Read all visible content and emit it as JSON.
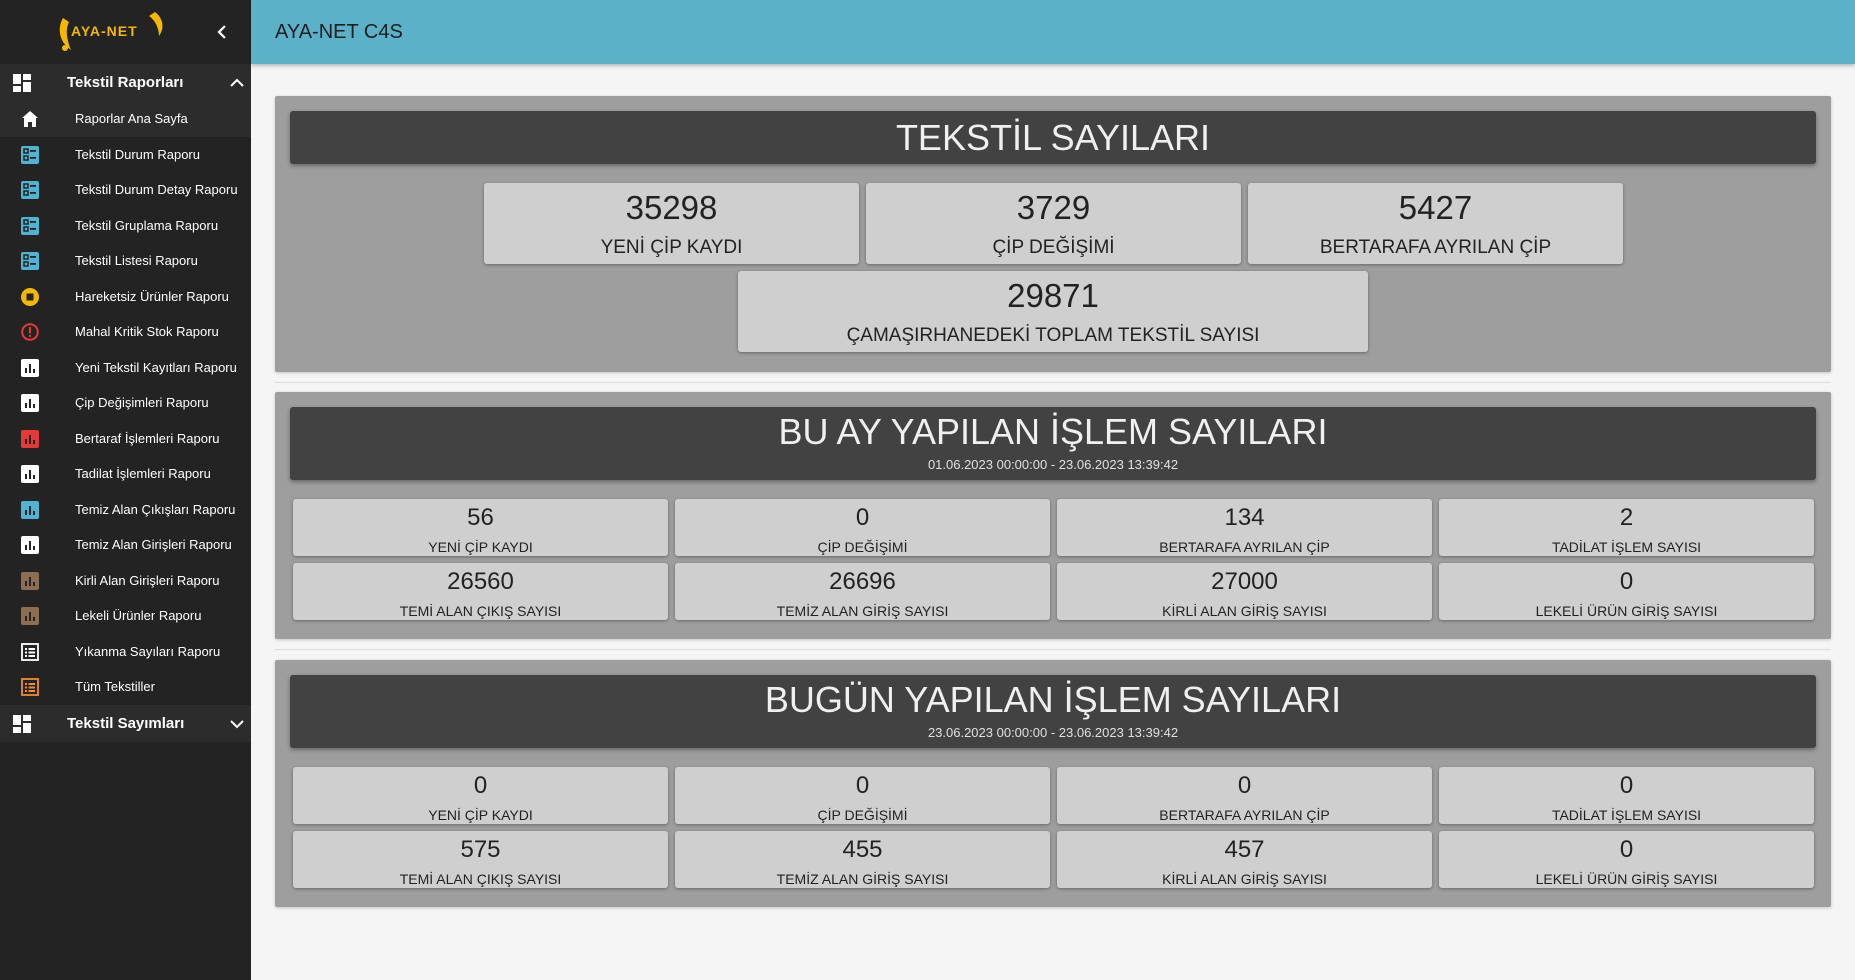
{
  "app": {
    "logo_text": "AYA-NET",
    "header_title": "AYA-NET C4S"
  },
  "colors": {
    "header": "#5ab1c8",
    "sidebar": "#232323",
    "logo": "#f5b800",
    "section_bg": "#9e9e9e",
    "section_head": "#424242",
    "card": "#cfcfcf"
  },
  "sidebar": {
    "group1": {
      "label": "Tekstil Raporları",
      "icon": "dashboard-icon",
      "expanded": true
    },
    "items": [
      {
        "label": "Raporlar Ana Sayfa",
        "icon": "home-icon",
        "color": "#ffffff"
      },
      {
        "label": "Tekstil Durum Raporu",
        "icon": "list-status-icon",
        "color": "#4fb3d1"
      },
      {
        "label": "Tekstil Durum Detay Raporu",
        "icon": "list-status-icon",
        "color": "#4fb3d1"
      },
      {
        "label": "Tekstil Gruplama Raporu",
        "icon": "list-status-icon",
        "color": "#4fb3d1"
      },
      {
        "label": "Tekstil Listesi Raporu",
        "icon": "list-status-icon",
        "color": "#4fb3d1"
      },
      {
        "label": "Hareketsiz Ürünler Raporu",
        "icon": "stop-circle-icon",
        "color": "#f5b800"
      },
      {
        "label": "Mahal Kritik Stok Raporu",
        "icon": "alert-circle-icon",
        "color": "#e53935"
      },
      {
        "label": "Yeni Tekstil Kayıtları Raporu",
        "icon": "bar-chart-icon",
        "color": "#ffffff"
      },
      {
        "label": "Çip Değişimleri Raporu",
        "icon": "bar-chart-icon",
        "color": "#ffffff"
      },
      {
        "label": "Bertaraf İşlemleri Raporu",
        "icon": "bar-chart-icon",
        "color": "#e53935"
      },
      {
        "label": "Tadilat İşlemleri Raporu",
        "icon": "bar-chart-icon",
        "color": "#ffffff"
      },
      {
        "label": "Temiz Alan Çıkışları Raporu",
        "icon": "bar-chart-icon",
        "color": "#4fb3d1"
      },
      {
        "label": "Temiz Alan Girişleri Raporu",
        "icon": "bar-chart-icon",
        "color": "#ffffff"
      },
      {
        "label": "Kirli Alan Girişleri Raporu",
        "icon": "bar-chart-icon",
        "color": "#8d6e52"
      },
      {
        "label": "Lekeli Ürünler Raporu",
        "icon": "bar-chart-icon",
        "color": "#8d6e52"
      },
      {
        "label": "Yıkanma Sayıları Raporu",
        "icon": "list-alt-icon",
        "color": "#ffffff"
      },
      {
        "label": "Tüm Tekstiller",
        "icon": "list-alt-icon",
        "color": "#f28c28"
      }
    ],
    "group2": {
      "label": "Tekstil Sayımları",
      "icon": "dashboard-icon",
      "expanded": false
    }
  },
  "sections": {
    "textile": {
      "title": "TEKSTİL SAYILARI",
      "cards": [
        {
          "value": "35298",
          "label": "YENİ ÇİP KAYDI"
        },
        {
          "value": "3729",
          "label": "ÇİP DEĞİŞİMİ"
        },
        {
          "value": "5427",
          "label": "BERTARAFA AYRILAN ÇİP"
        },
        {
          "value": "29871",
          "label": "ÇAMAŞIRHANEDEKİ TOPLAM TEKSTİL SAYISI"
        }
      ]
    },
    "month": {
      "title": "BU AY YAPILAN İŞLEM SAYILARI",
      "date_range": "01.06.2023 00:00:00 - 23.06.2023 13:39:42",
      "cards": [
        {
          "value": "56",
          "label": "YENİ ÇİP KAYDI"
        },
        {
          "value": "0",
          "label": "ÇİP DEĞİŞİMİ"
        },
        {
          "value": "134",
          "label": "BERTARAFA AYRILAN ÇİP"
        },
        {
          "value": "2",
          "label": "TADİLAT İŞLEM SAYISI"
        },
        {
          "value": "26560",
          "label": "TEMİ ALAN ÇIKIŞ SAYISI"
        },
        {
          "value": "26696",
          "label": "TEMİZ ALAN GİRİŞ SAYISI"
        },
        {
          "value": "27000",
          "label": "KİRLİ ALAN GİRİŞ SAYISI"
        },
        {
          "value": "0",
          "label": "LEKELİ ÜRÜN GİRİŞ SAYISI"
        }
      ]
    },
    "today": {
      "title": "BUGÜN YAPILAN İŞLEM SAYILARI",
      "date_range": "23.06.2023 00:00:00 - 23.06.2023 13:39:42",
      "cards": [
        {
          "value": "0",
          "label": "YENİ ÇİP KAYDI"
        },
        {
          "value": "0",
          "label": "ÇİP DEĞİŞİMİ"
        },
        {
          "value": "0",
          "label": "BERTARAFA AYRILAN ÇİP"
        },
        {
          "value": "0",
          "label": "TADİLAT İŞLEM SAYISI"
        },
        {
          "value": "575",
          "label": "TEMİ ALAN ÇIKIŞ SAYISI"
        },
        {
          "value": "455",
          "label": "TEMİZ ALAN GİRİŞ SAYISI"
        },
        {
          "value": "457",
          "label": "KİRLİ ALAN GİRİŞ SAYISI"
        },
        {
          "value": "0",
          "label": "LEKELİ ÜRÜN GİRİŞ SAYISI"
        }
      ]
    }
  }
}
